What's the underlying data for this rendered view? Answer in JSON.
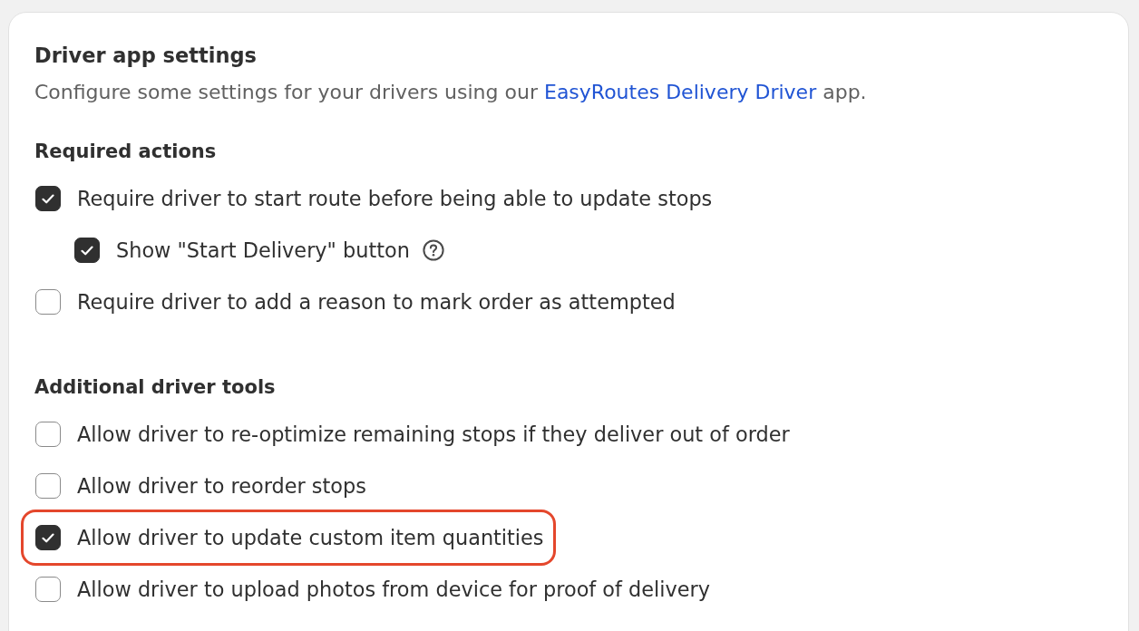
{
  "card": {
    "title": "Driver app settings",
    "description": {
      "before": "Configure some settings for your drivers using our",
      "link": "EasyRoutes Delivery Driver",
      "after": "app."
    },
    "sections": [
      {
        "heading": "Required actions",
        "options": [
          {
            "label": "Require driver to start route before being able to update stops",
            "checked": true,
            "help": false,
            "highlighted": false,
            "children": [
              {
                "label": "Show \"Start Delivery\" button",
                "checked": true,
                "help": true,
                "highlighted": false
              }
            ]
          },
          {
            "label": "Require driver to add a reason to mark order as attempted",
            "checked": false,
            "help": false,
            "highlighted": false
          }
        ]
      },
      {
        "heading": "Additional driver tools",
        "options": [
          {
            "label": "Allow driver to re-optimize remaining stops if they deliver out of order",
            "checked": false,
            "help": false,
            "highlighted": false
          },
          {
            "label": "Allow driver to reorder stops",
            "checked": false,
            "help": false,
            "highlighted": false
          },
          {
            "label": "Allow driver to update custom item quantities",
            "checked": true,
            "help": false,
            "highlighted": true
          },
          {
            "label": "Allow driver to upload photos from device for proof of delivery",
            "checked": false,
            "help": false,
            "highlighted": false
          }
        ]
      }
    ]
  }
}
